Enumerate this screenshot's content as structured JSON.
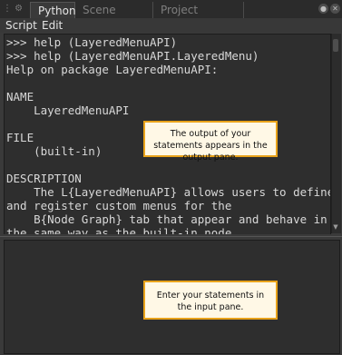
{
  "tabs": [
    {
      "label": "Python",
      "active": true
    },
    {
      "label": "Scene Graph",
      "active": false
    },
    {
      "label": "Project Settings",
      "active": false
    }
  ],
  "menu": {
    "script": "Script",
    "edit": "Edit"
  },
  "output_lines": [
    ">>> help (LayeredMenuAPI)",
    ">>> help (LayeredMenuAPI.LayeredMenu)",
    "Help on package LayeredMenuAPI:",
    "",
    "NAME",
    "    LayeredMenuAPI",
    "",
    "FILE",
    "    (built-in)",
    "",
    "DESCRIPTION",
    "    The L{LayeredMenuAPI} allows users to define",
    "and register custom menus for the",
    "    B{Node Graph} tab that appear and behave in",
    "the same way as the built-in node"
  ],
  "callouts": {
    "output": "The output of your statements appears in the output pane.",
    "input": "Enter your statements in the input pane."
  },
  "colors": {
    "accent_border": "#e8a21a",
    "pane_bg": "#2e2e2e",
    "text": "#d8d8d8"
  }
}
